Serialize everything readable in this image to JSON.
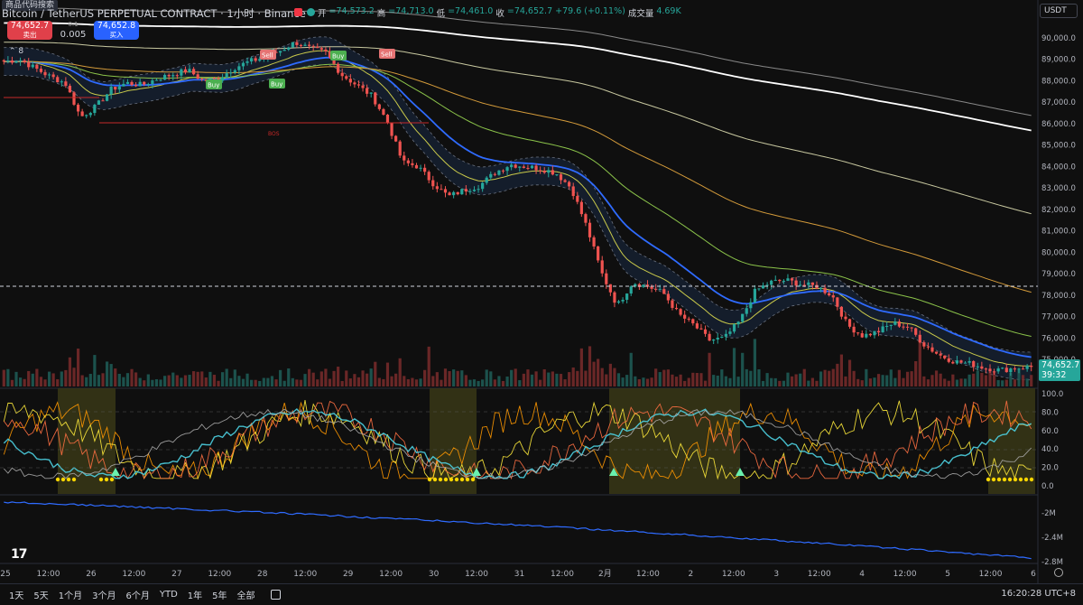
{
  "header": {
    "symbol_search": "商品代码搜索",
    "title": "Bitcoin / TetherUS PERPETUAL CONTRACT · 1小时 · Binance",
    "ohlc": {
      "open_label": "开",
      "open": "=74,573.2",
      "high_label": "高",
      "high": "=74,713.0",
      "low_label": "低",
      "low": "=74,461.0",
      "close_label": "收",
      "close": "=74,652.7",
      "change": "+79.6 (+0.11%)",
      "volume_label": "成交量",
      "volume": "4.69K"
    },
    "currency": "USDT"
  },
  "trade": {
    "sell_price": "74,652.7",
    "sell_label": "卖出",
    "buy_price": "74,652.8",
    "buy_label": "买入",
    "spread_top": "0.1",
    "spread": "0.005",
    "indicator_count": "8"
  },
  "price_axis": {
    "labels": [
      "90,000.0",
      "89,000.0",
      "88,000.0",
      "87,000.0",
      "86,000.0",
      "85,000.0",
      "84,000.0",
      "83,000.0",
      "82,000.0",
      "81,000.0",
      "80,000.0",
      "79,000.0",
      "78,000.0",
      "77,000.0",
      "76,000.0",
      "75,000.0"
    ],
    "current_price": "74,652.7",
    "countdown": "39:32"
  },
  "osc_axis": {
    "labels": [
      "100.0",
      "80.0",
      "60.0",
      "40.0",
      "20.0",
      "0.0"
    ]
  },
  "cvd_axis": {
    "labels": [
      "-2M",
      "-2.4M",
      "-2.8M"
    ]
  },
  "time_axis": {
    "labels": [
      "25",
      "12:00",
      "26",
      "12:00",
      "27",
      "12:00",
      "28",
      "12:00",
      "29",
      "12:00",
      "30",
      "12:00",
      "31",
      "12:00",
      "2月",
      "12:00",
      "2",
      "12:00",
      "3",
      "12:00",
      "4",
      "12:00",
      "5",
      "12:00",
      "6"
    ]
  },
  "annotations": {
    "sell": "Sell",
    "buy": "Buy",
    "bos": "BOS"
  },
  "bottom": {
    "ranges": [
      "1天",
      "5天",
      "1个月",
      "3个月",
      "6个月",
      "YTD",
      "1年",
      "5年",
      "全部"
    ],
    "clock": "16:20:28 UTC+8"
  },
  "colors": {
    "up": "#26a69a",
    "down": "#ef5350",
    "ema_blue": "#2f6bff",
    "ema_white": "#ffffff",
    "band": "#1a2a44",
    "highlight": "#3b3a16"
  },
  "chart_data": {
    "type": "candlestick",
    "series": [
      {
        "name": "price",
        "values": [
          88900,
          89000,
          88600,
          88200,
          87900,
          86300,
          86800,
          87600,
          87900,
          87800,
          88100,
          88300,
          88500,
          88000,
          88100,
          88600,
          88900,
          89100,
          89400,
          89800,
          89500,
          89300,
          88300,
          87800,
          87300,
          86100,
          84200,
          84000,
          83200,
          82600,
          82900,
          83100,
          83700,
          84100,
          84000,
          83900,
          83700,
          83000,
          81200,
          79000,
          77500,
          78600,
          78400,
          78100,
          77100,
          76600,
          75900,
          76000,
          76800,
          78200,
          78600,
          78700,
          78500,
          78400,
          78000,
          76600,
          76100,
          76300,
          76700,
          76500,
          75700,
          75200,
          74900,
          74800,
          74600,
          74500,
          74600,
          74652.7
        ]
      }
    ],
    "ylim": [
      74600,
      90800
    ]
  }
}
